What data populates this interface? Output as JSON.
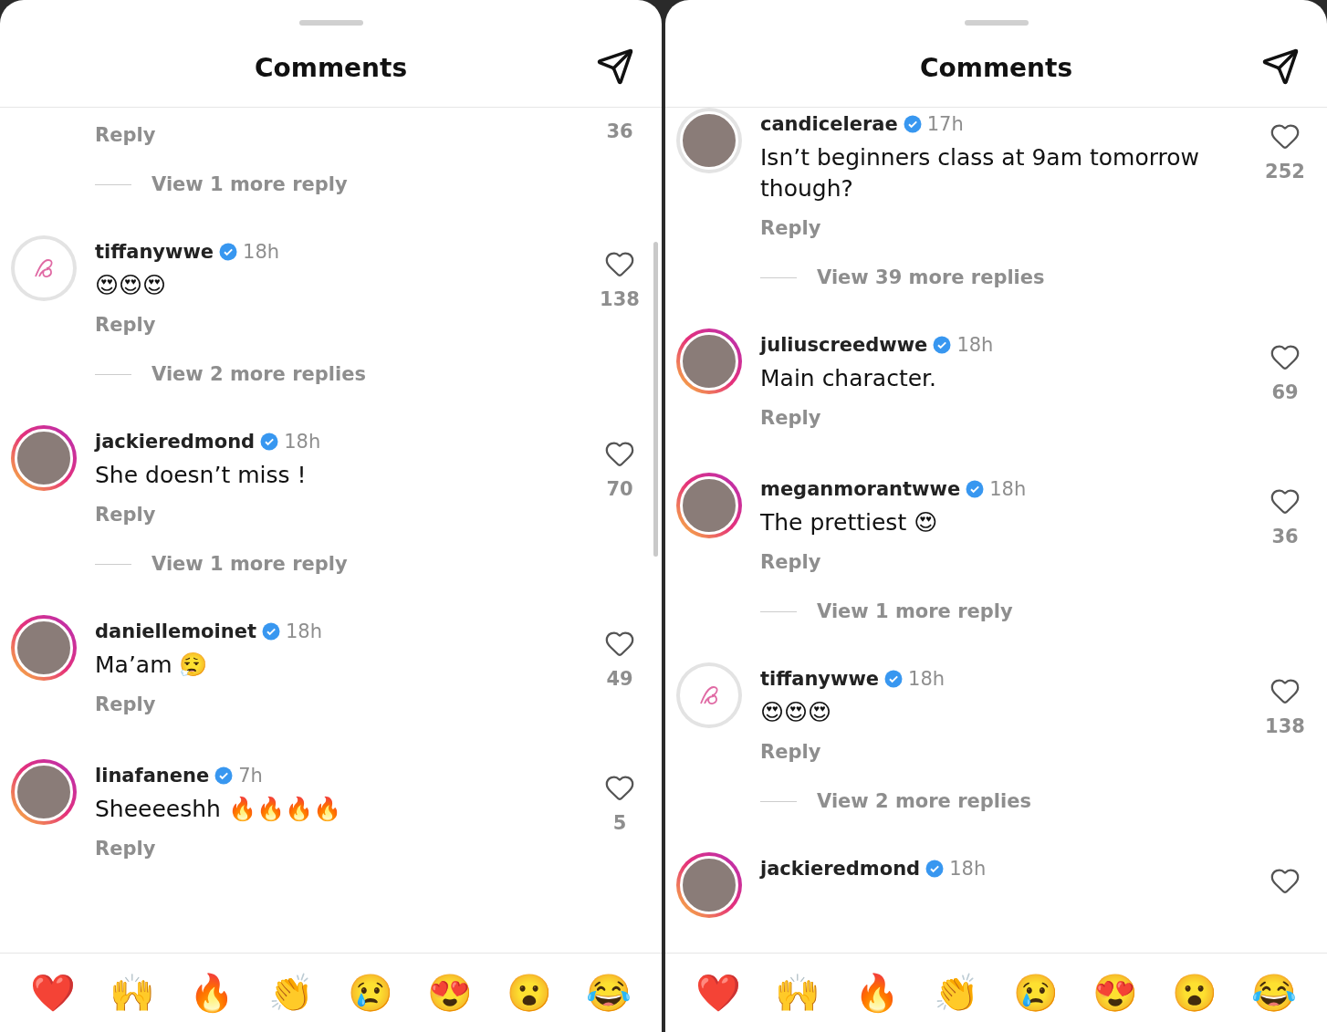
{
  "panels": [
    {
      "title": "Comments",
      "scrollbar_visible": true,
      "comments": [
        {
          "kind": "cut_top",
          "likes": "36",
          "reply": "Reply",
          "more_replies": "View 1 more reply"
        },
        {
          "kind": "full",
          "avatar": {
            "kind": "logo",
            "story_ring": false
          },
          "username": "tiffanywwe",
          "verified": true,
          "time": "18h",
          "text": "😍😍😍",
          "reply": "Reply",
          "likes": "138",
          "more_replies": "View 2 more replies"
        },
        {
          "kind": "full",
          "avatar": {
            "kind": "photo",
            "story_ring": true
          },
          "username": "jackieredmond",
          "verified": true,
          "time": "18h",
          "text": "She doesn’t miss !",
          "reply": "Reply",
          "likes": "70",
          "more_replies": "View 1 more reply"
        },
        {
          "kind": "full",
          "avatar": {
            "kind": "photo",
            "story_ring": true
          },
          "username": "daniellemoinet",
          "verified": true,
          "time": "18h",
          "text": "Ma’am 😮‍💨",
          "reply": "Reply",
          "likes": "49"
        },
        {
          "kind": "full",
          "avatar": {
            "kind": "photo",
            "story_ring": true
          },
          "username": "linafanene",
          "verified": true,
          "time": "7h",
          "text": "Sheeeeshh 🔥🔥🔥🔥",
          "reply": "Reply",
          "likes": "5"
        }
      ],
      "reactions": [
        "❤️",
        "🙌",
        "🔥",
        "👏",
        "😢",
        "😍",
        "😮",
        "😂"
      ]
    },
    {
      "title": "Comments",
      "scrollbar_visible": false,
      "comments": [
        {
          "kind": "full",
          "avatar": {
            "kind": "photo",
            "story_ring": false
          },
          "username": "candicelerae",
          "verified": true,
          "time": "17h",
          "text": "Isn’t beginners class at 9am tomorrow though?",
          "reply": "Reply",
          "likes": "252",
          "more_replies": "View 39 more replies"
        },
        {
          "kind": "full",
          "avatar": {
            "kind": "photo",
            "story_ring": true
          },
          "username": "juliuscreedwwe",
          "verified": true,
          "time": "18h",
          "text": "Main character.",
          "reply": "Reply",
          "likes": "69"
        },
        {
          "kind": "full",
          "avatar": {
            "kind": "photo",
            "story_ring": true
          },
          "username": "meganmorantwwe",
          "verified": true,
          "time": "18h",
          "text": "The prettiest 😍",
          "reply": "Reply",
          "likes": "36",
          "more_replies": "View 1 more reply"
        },
        {
          "kind": "full",
          "avatar": {
            "kind": "logo",
            "story_ring": false
          },
          "username": "tiffanywwe",
          "verified": true,
          "time": "18h",
          "text": "😍😍😍",
          "reply": "Reply",
          "likes": "138",
          "more_replies": "View 2 more replies"
        },
        {
          "kind": "cut_bottom",
          "avatar": {
            "kind": "photo",
            "story_ring": true
          },
          "username": "jackieredmond",
          "verified": true,
          "time": "18h"
        }
      ],
      "reactions": [
        "❤️",
        "🙌",
        "🔥",
        "👏",
        "😢",
        "😍",
        "😮",
        "😂"
      ]
    }
  ]
}
